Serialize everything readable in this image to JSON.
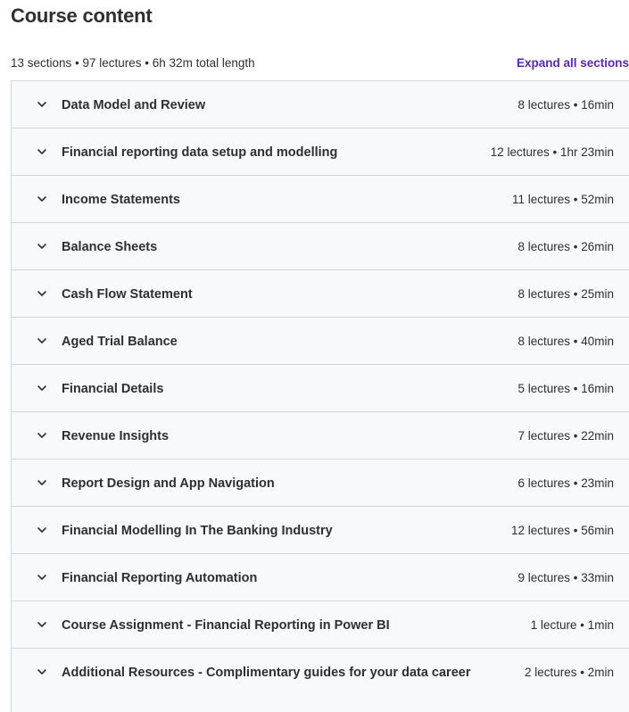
{
  "header": {
    "title": "Course content",
    "summary": "13 sections • 97 lectures • 6h 32m total length",
    "expand_all_label": "Expand all sections"
  },
  "icons": {
    "section_toggle": "chevron-down-icon"
  },
  "colors": {
    "link": "#5624d0",
    "section_background": "#f7f9fa",
    "border": "#d1d7dc",
    "text": "#2d2f31"
  },
  "sections": [
    {
      "title": "Data Model and Review",
      "meta": "8 lectures • 16min"
    },
    {
      "title": "Financial reporting data setup and modelling",
      "meta": "12 lectures • 1hr 23min"
    },
    {
      "title": "Income Statements",
      "meta": "11 lectures • 52min"
    },
    {
      "title": "Balance Sheets",
      "meta": "8 lectures • 26min"
    },
    {
      "title": "Cash Flow Statement",
      "meta": "8 lectures • 25min"
    },
    {
      "title": "Aged Trial Balance",
      "meta": "8 lectures • 40min"
    },
    {
      "title": "Financial Details",
      "meta": "5 lectures • 16min"
    },
    {
      "title": "Revenue Insights",
      "meta": "7 lectures • 22min"
    },
    {
      "title": "Report Design and App Navigation",
      "meta": "6 lectures • 23min"
    },
    {
      "title": "Financial Modelling In The Banking Industry",
      "meta": "12 lectures • 56min"
    },
    {
      "title": "Financial Reporting Automation",
      "meta": "9 lectures • 33min"
    },
    {
      "title": "Course Assignment - Financial Reporting in Power BI",
      "meta": "1 lecture • 1min"
    },
    {
      "title": "Additional Resources - Complimentary guides for your data career",
      "meta": "2 lectures • 2min"
    }
  ]
}
